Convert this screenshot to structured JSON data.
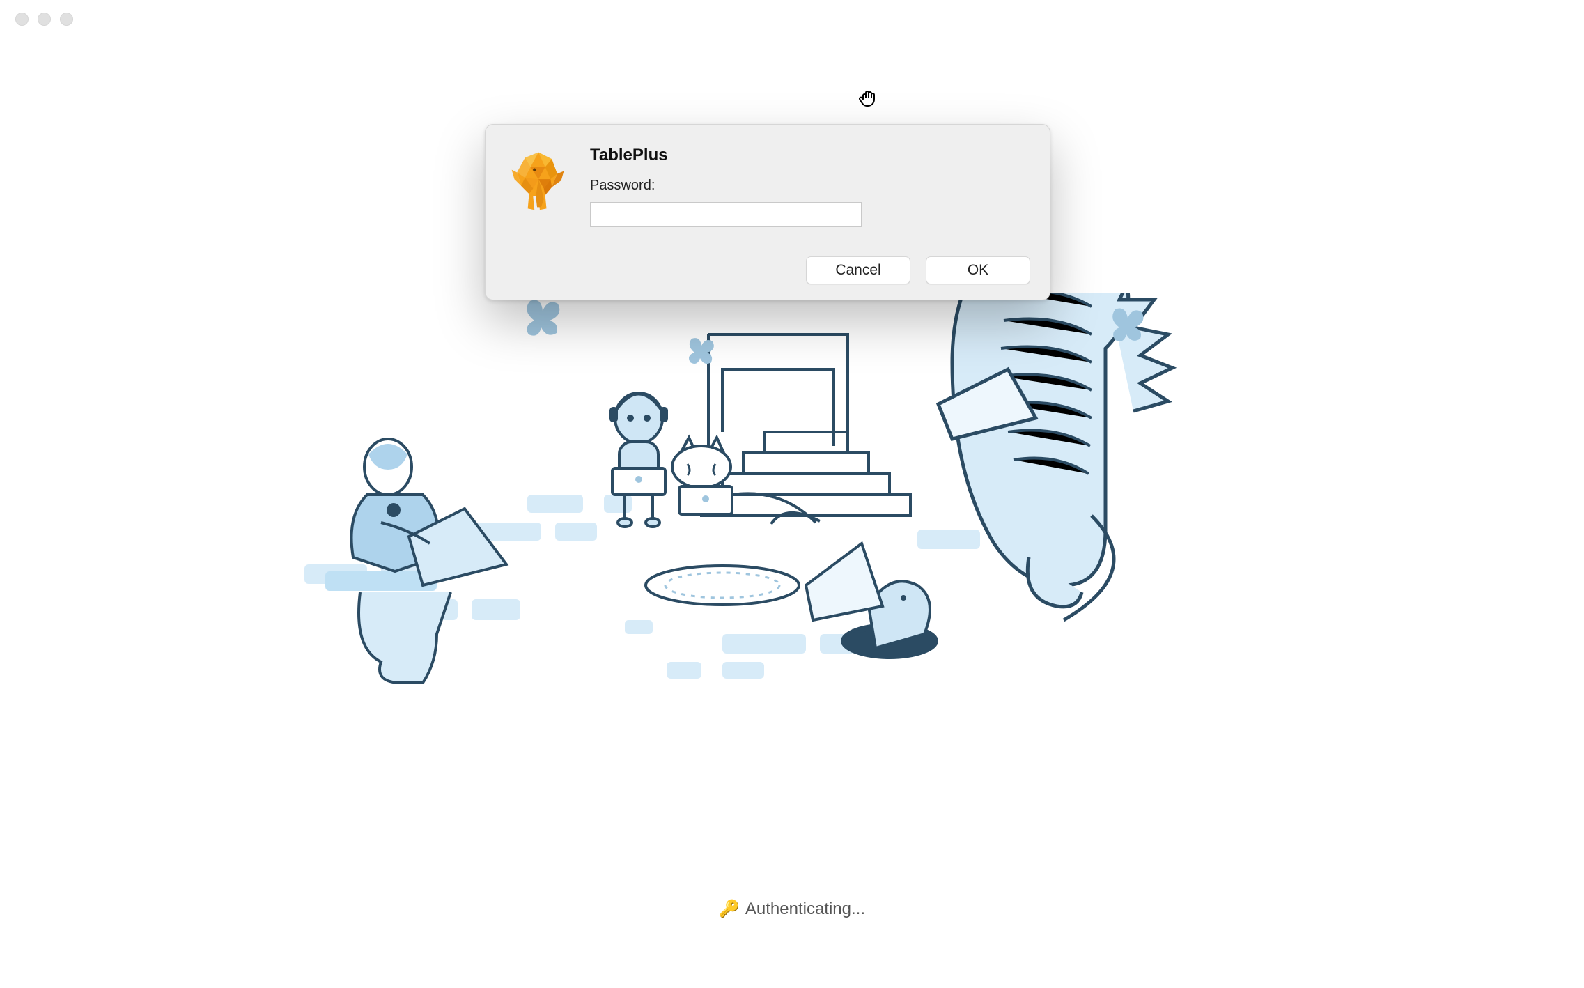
{
  "dialog": {
    "title": "TablePlus",
    "password_label": "Password:",
    "password_value": "",
    "cancel_label": "Cancel",
    "ok_label": "OK"
  },
  "status": {
    "icon": "🔑",
    "text": "Authenticating..."
  },
  "cursor_glyph": "✋"
}
